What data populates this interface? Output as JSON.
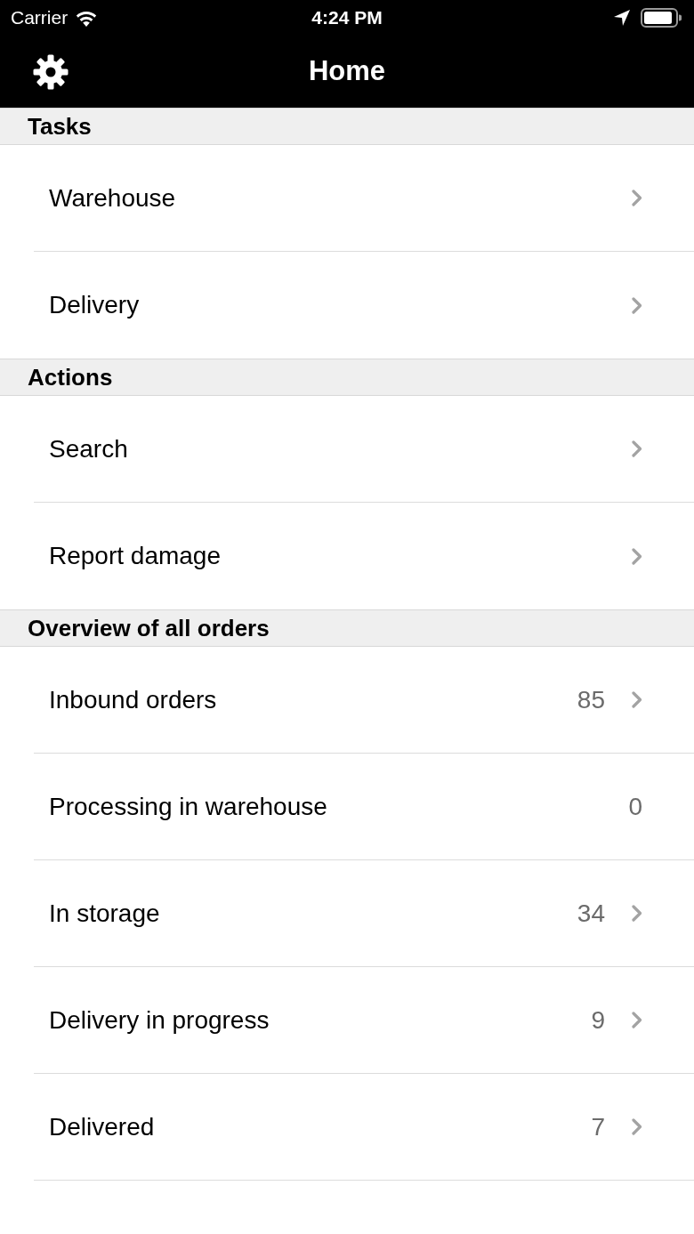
{
  "status_bar": {
    "carrier": "Carrier",
    "time": "4:24 PM"
  },
  "nav_bar": {
    "title": "Home"
  },
  "sections": [
    {
      "title": "Tasks",
      "rows": [
        {
          "label": "Warehouse",
          "disclosure": true
        },
        {
          "label": "Delivery",
          "disclosure": true
        }
      ]
    },
    {
      "title": "Actions",
      "rows": [
        {
          "label": "Search",
          "disclosure": true
        },
        {
          "label": "Report damage",
          "disclosure": true
        }
      ]
    },
    {
      "title": "Overview of all orders",
      "rows": [
        {
          "label": "Inbound orders",
          "count": "85",
          "disclosure": true
        },
        {
          "label": "Processing in warehouse",
          "count": "0",
          "disclosure": false
        },
        {
          "label": "In storage",
          "count": "34",
          "disclosure": true
        },
        {
          "label": "Delivery in progress",
          "count": "9",
          "disclosure": true
        },
        {
          "label": "Delivered",
          "count": "7",
          "disclosure": true
        }
      ]
    }
  ]
}
